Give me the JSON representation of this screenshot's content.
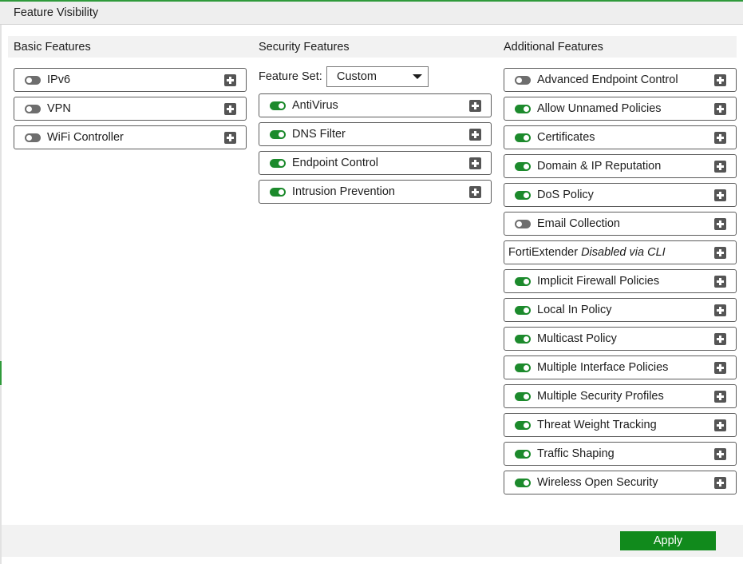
{
  "page": {
    "title": "Feature Visibility"
  },
  "colors": {
    "accent": "#1c8a2c",
    "toggle_off": "#6e6e6e",
    "apply_button": "#118a1c"
  },
  "columns": {
    "basic": {
      "header": "Basic Features",
      "items": [
        {
          "label": "IPv6",
          "enabled": false,
          "icon": "expand-plus-icon"
        },
        {
          "label": "VPN",
          "enabled": false,
          "icon": "expand-plus-icon"
        },
        {
          "label": "WiFi Controller",
          "enabled": false,
          "icon": "expand-plus-icon"
        }
      ]
    },
    "security": {
      "header": "Security Features",
      "feature_set": {
        "label": "Feature Set:",
        "value": "Custom"
      },
      "items": [
        {
          "label": "AntiVirus",
          "enabled": true
        },
        {
          "label": "DNS Filter",
          "enabled": true
        },
        {
          "label": "Endpoint Control",
          "enabled": true
        },
        {
          "label": "Intrusion Prevention",
          "enabled": true
        }
      ]
    },
    "additional": {
      "header": "Additional Features",
      "items": [
        {
          "label": "Advanced Endpoint Control",
          "enabled": false
        },
        {
          "label": "Allow Unnamed Policies",
          "enabled": true
        },
        {
          "label": "Certificates",
          "enabled": true
        },
        {
          "label": "Domain & IP Reputation",
          "enabled": true
        },
        {
          "label": "DoS Policy",
          "enabled": true
        },
        {
          "label": "Email Collection",
          "enabled": false
        },
        {
          "label": "FortiExtender",
          "note": "Disabled via CLI",
          "enabled": null
        },
        {
          "label": "Implicit Firewall Policies",
          "enabled": true
        },
        {
          "label": "Local In Policy",
          "enabled": true
        },
        {
          "label": "Multicast Policy",
          "enabled": true
        },
        {
          "label": "Multiple Interface Policies",
          "enabled": true
        },
        {
          "label": "Multiple Security Profiles",
          "enabled": true
        },
        {
          "label": "Threat Weight Tracking",
          "enabled": true
        },
        {
          "label": "Traffic Shaping",
          "enabled": true
        },
        {
          "label": "Wireless Open Security",
          "enabled": true
        }
      ]
    }
  },
  "footer": {
    "apply_label": "Apply"
  }
}
